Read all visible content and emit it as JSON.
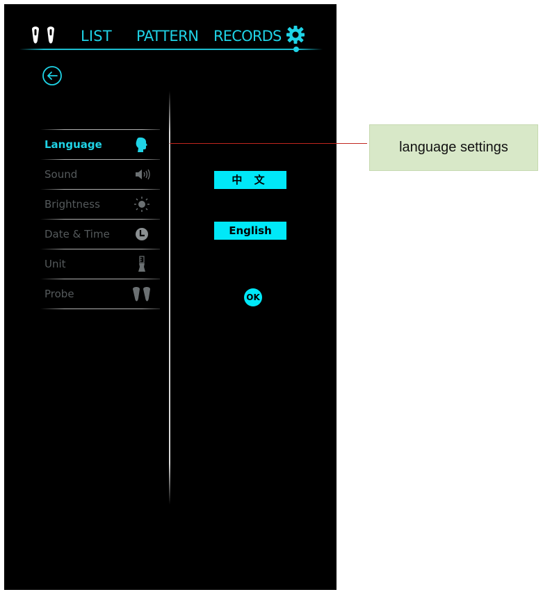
{
  "nav": {
    "list": "LIST",
    "pattern": "PATTERN",
    "records": "RECORDS",
    "icons": [
      "probe-pair-icon",
      "gear-icon"
    ]
  },
  "back_icon": "arrow-left-circle-icon",
  "menu": {
    "items": [
      {
        "label": "Language",
        "icon": "head-profile-icon",
        "active": true
      },
      {
        "label": "Sound",
        "icon": "speaker-icon",
        "active": false
      },
      {
        "label": "Brightness",
        "icon": "sun-icon",
        "active": false
      },
      {
        "label": "Date & Time",
        "icon": "clock-icon",
        "active": false
      },
      {
        "label": "Unit",
        "icon": "ruler-icon",
        "active": false
      },
      {
        "label": "Probe",
        "icon": "probe-pair-icon",
        "active": false
      }
    ]
  },
  "language": {
    "options": [
      "中 文",
      "English"
    ],
    "ok_label": "OK"
  },
  "callout": {
    "text": "language settings"
  },
  "colors": {
    "accent": "#1fd3e6",
    "button": "#00e8f8",
    "background": "#000000",
    "inactive_text": "#555a5c",
    "callout_bg": "#d8e8c8",
    "callout_line": "#c0261f"
  }
}
